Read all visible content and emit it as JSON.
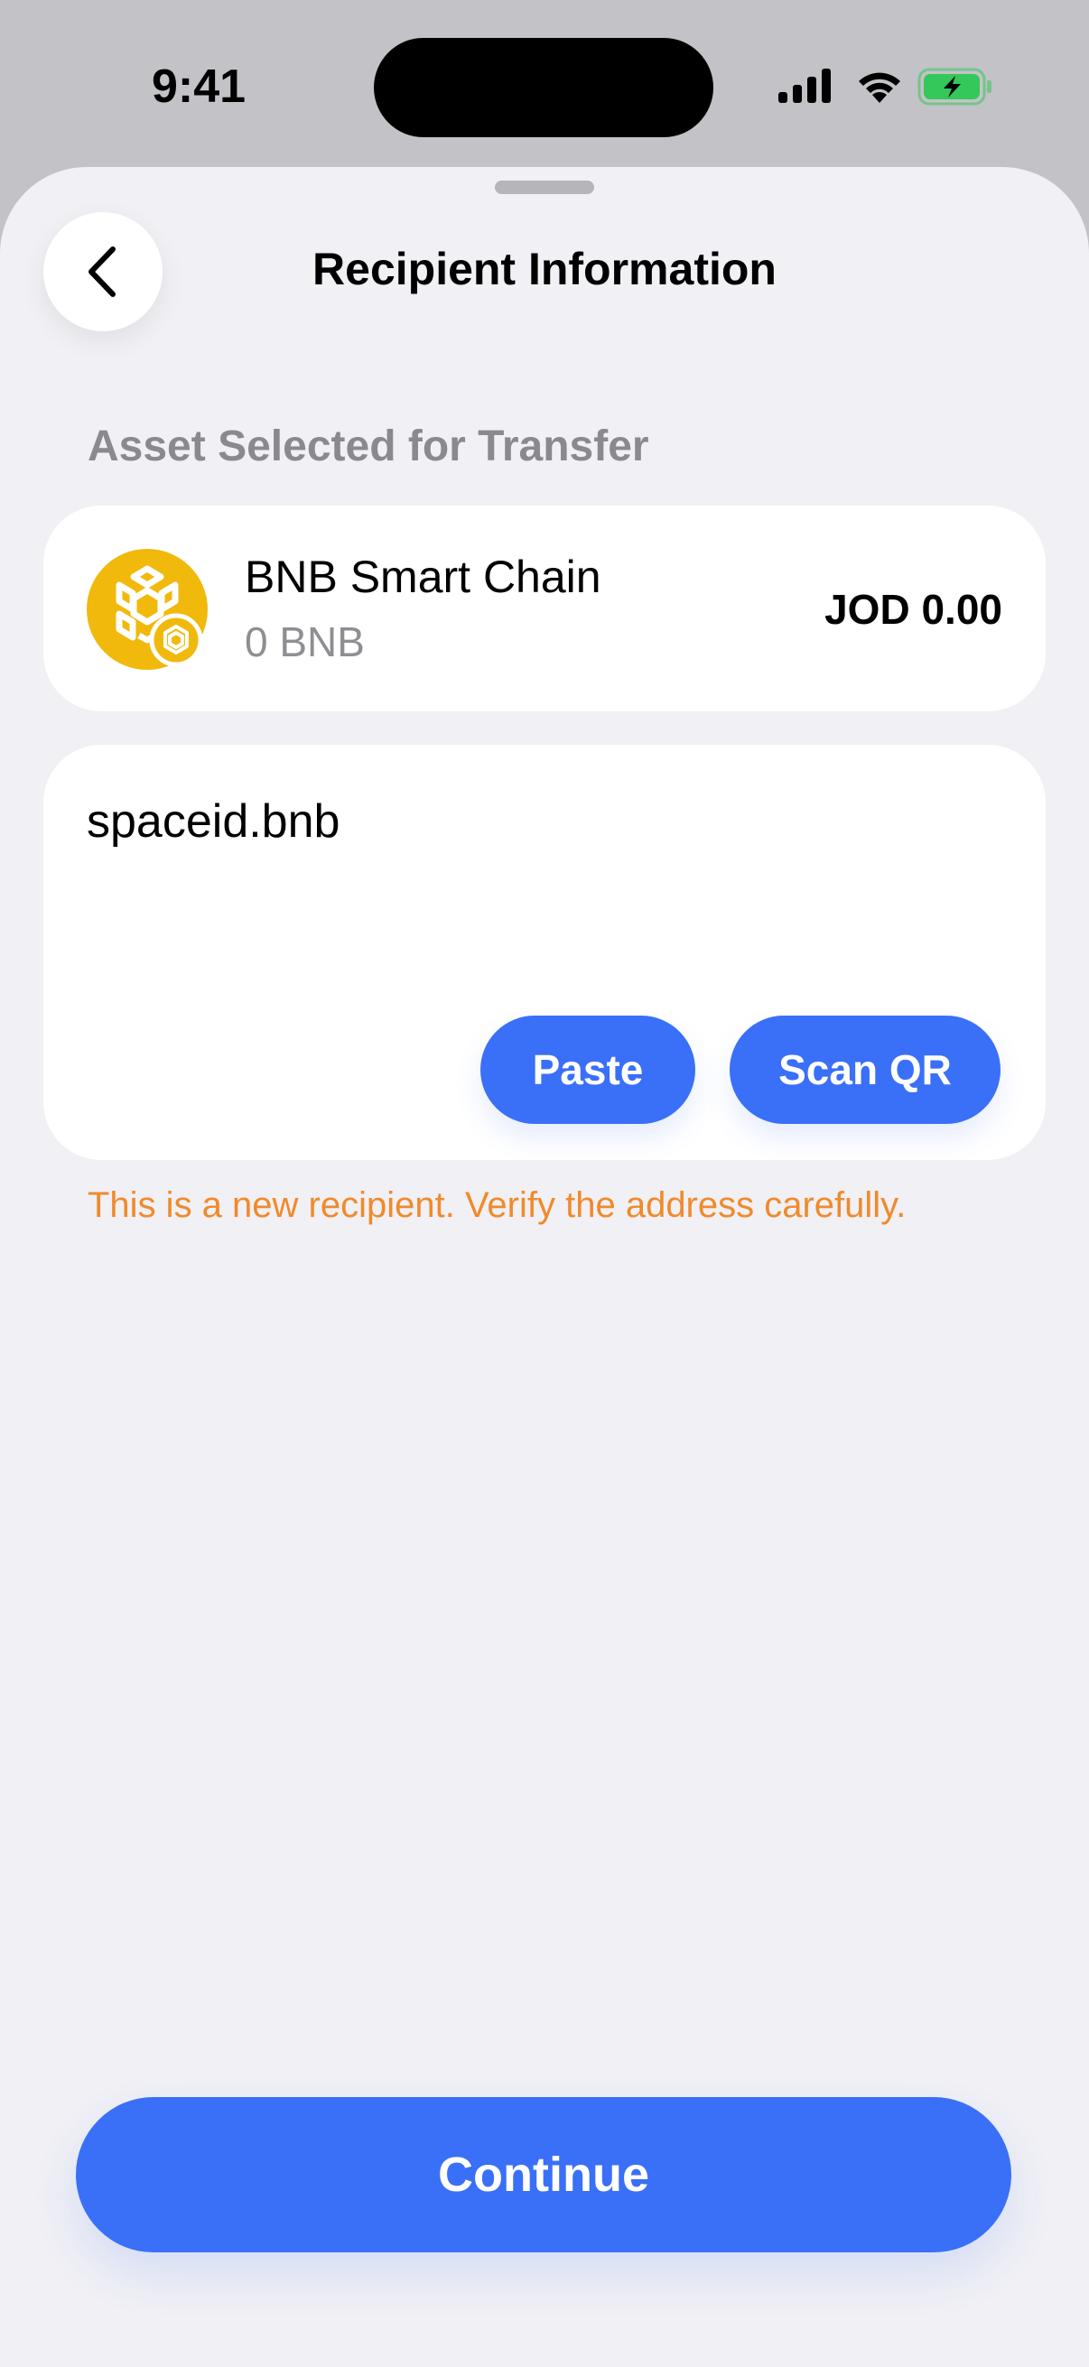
{
  "status_bar": {
    "time": "9:41",
    "icons": [
      "cellular-signal-icon",
      "wifi-icon",
      "battery-charging-icon"
    ],
    "battery_color": "#34c759"
  },
  "header": {
    "title": "Recipient Information",
    "back_icon": "chevron-left-icon"
  },
  "asset_section": {
    "label": "Asset Selected for Transfer",
    "asset": {
      "name": "BNB Smart Chain",
      "balance": "0 BNB",
      "fiat_value": "JOD 0.00",
      "icon": "bnb-coin-icon",
      "icon_color": "#f0b90b"
    }
  },
  "recipient": {
    "address_value": "spaceid.bnb",
    "paste_label": "Paste",
    "scan_label": "Scan QR",
    "warning": "This is a new recipient. Verify the address carefully."
  },
  "footer": {
    "continue_label": "Continue"
  },
  "colors": {
    "accent": "#3a6ff8",
    "warning": "#f08a2a",
    "sheet_background": "#f0f0f5"
  }
}
